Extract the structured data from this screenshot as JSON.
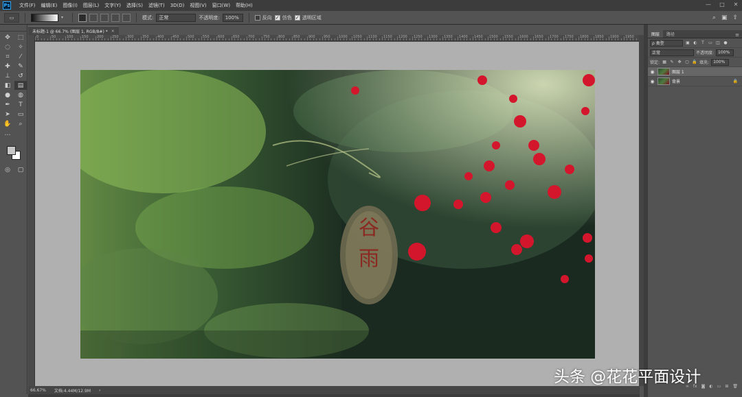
{
  "app": {
    "logo": "Ps",
    "menu": [
      "文件(F)",
      "编辑(E)",
      "图像(I)",
      "图层(L)",
      "文字(Y)",
      "选择(S)",
      "滤镜(T)",
      "3D(D)",
      "视图(V)",
      "窗口(W)",
      "帮助(H)"
    ],
    "window_controls": [
      "—",
      "□",
      "✕"
    ]
  },
  "options": {
    "mode_label": "模式:",
    "mode_value": "正常",
    "opacity_label": "不透明度:",
    "opacity_value": "100%",
    "reverse_label": "反向",
    "reverse_checked": false,
    "dither_label": "仿色",
    "dither_checked": true,
    "transparency_label": "透明区域",
    "transparency_checked": true
  },
  "document": {
    "tab_title": "未标题-1 @ 66.7% (图层 1, RGB/8#) *",
    "tab_close": "×",
    "ruler_marks": [
      "0",
      "50",
      "100",
      "150",
      "200",
      "250",
      "300",
      "350",
      "400",
      "450",
      "500",
      "550",
      "600",
      "650",
      "700",
      "750",
      "800",
      "850",
      "900",
      "950",
      "1000",
      "1050",
      "1100",
      "1150",
      "1200",
      "1250",
      "1300",
      "1350",
      "1400",
      "1450",
      "1500",
      "1550",
      "1600",
      "1650",
      "1700",
      "1750",
      "1800",
      "1850",
      "1900",
      "1950"
    ],
    "lantern_text": [
      "谷",
      "雨"
    ]
  },
  "status": {
    "zoom": "66.67%",
    "doc_size": "文档:4.44M/12.9M",
    "arrow": "›"
  },
  "layers_panel": {
    "tabs": [
      "图层",
      "路径"
    ],
    "filter_label": "ρ 类型",
    "blend_mode": "正常",
    "opacity_label": "不透明度:",
    "opacity_value": "100%",
    "lock_label": "锁定:",
    "fill_label": "填充:",
    "fill_value": "100%",
    "layers": [
      {
        "name": "图层 1",
        "visible": true,
        "selected": true
      },
      {
        "name": "背景",
        "visible": true,
        "selected": false,
        "locked": true
      }
    ]
  },
  "watermark": "头条 @花花平面设计"
}
